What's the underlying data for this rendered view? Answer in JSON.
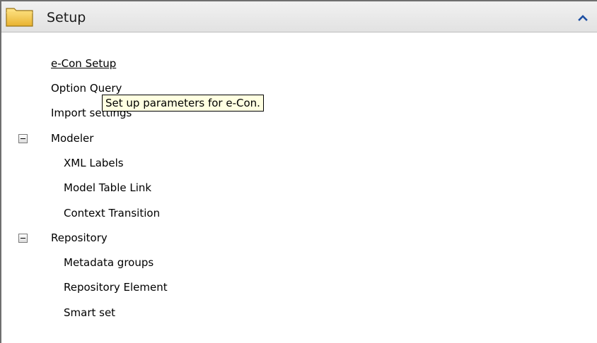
{
  "panel": {
    "title": "Setup",
    "folder_icon": "folder-icon",
    "collapse_icon": "chevron-up-icon"
  },
  "items": {
    "econ_setup": "e-Con Setup",
    "option_query": "Option Query",
    "import_settings": "Import settings",
    "modeler": "Modeler",
    "xml_labels": "XML Labels",
    "model_table_link": "Model Table Link",
    "context_transition": "Context Transition",
    "repository": "Repository",
    "metadata_groups": "Metadata groups",
    "repository_element": "Repository Element",
    "smart_set": "Smart set"
  },
  "tooltip": {
    "text": "Set up parameters for e-Con."
  }
}
